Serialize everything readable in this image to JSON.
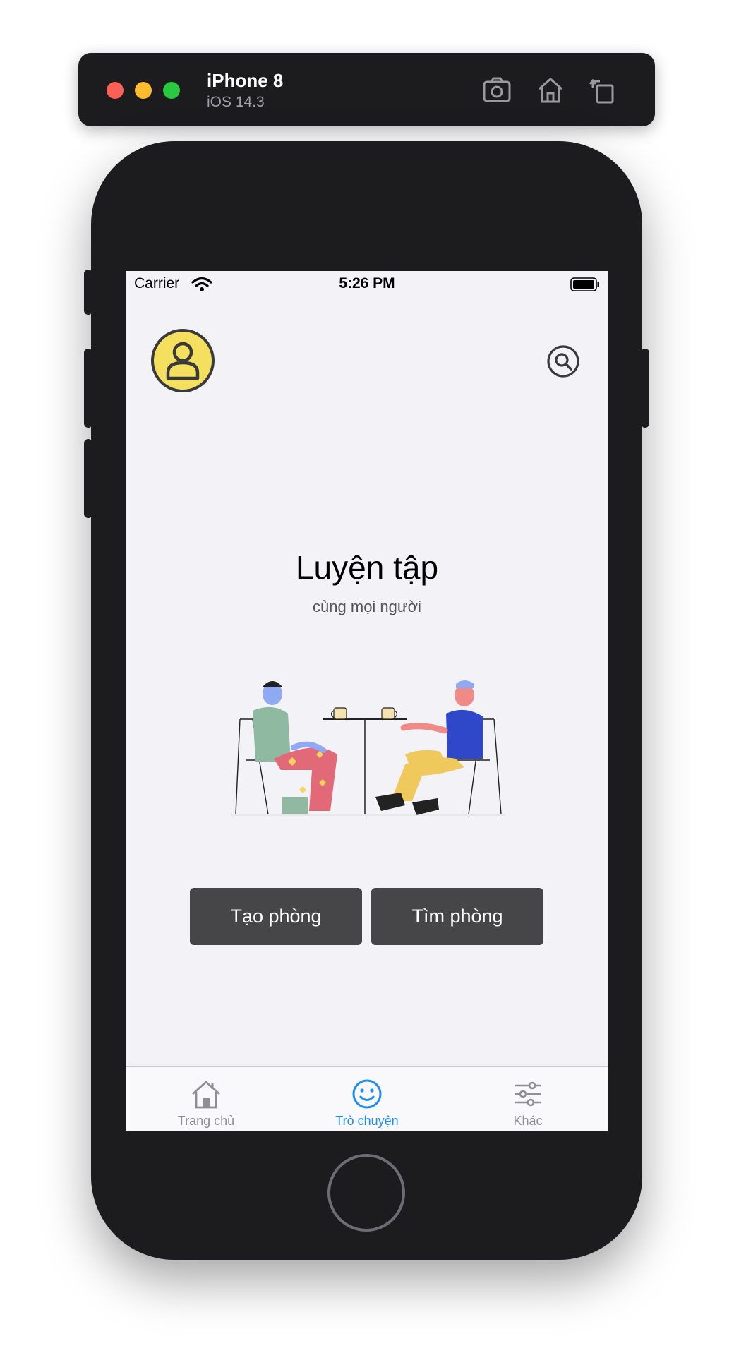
{
  "simulator": {
    "device_name": "iPhone 8",
    "os_version": "iOS 14.3",
    "buttons": {
      "screenshot": "camera-icon",
      "home": "home-icon",
      "rotate": "rotate-icon"
    }
  },
  "status_bar": {
    "carrier": "Carrier",
    "time": "5:26 PM"
  },
  "header": {
    "avatar_icon": "user-icon",
    "search_icon": "search-icon"
  },
  "main": {
    "title": "Luyện tập",
    "subtitle": "cùng mọi người",
    "illustration": "two-people-chatting-illustration",
    "buttons": {
      "create_room": "Tạo phòng",
      "find_room": "Tìm phòng"
    }
  },
  "tabbar": {
    "items": [
      {
        "label": "Trang chủ",
        "icon": "home-icon",
        "active": false
      },
      {
        "label": "Trò chuyện",
        "icon": "smile-icon",
        "active": true
      },
      {
        "label": "Khác",
        "icon": "sliders-icon",
        "active": false
      }
    ]
  },
  "colors": {
    "accent": "#1f8df5",
    "avatar_bg": "#f5df5f",
    "button_bg": "#464648",
    "screen_bg": "#f2f2f7"
  }
}
